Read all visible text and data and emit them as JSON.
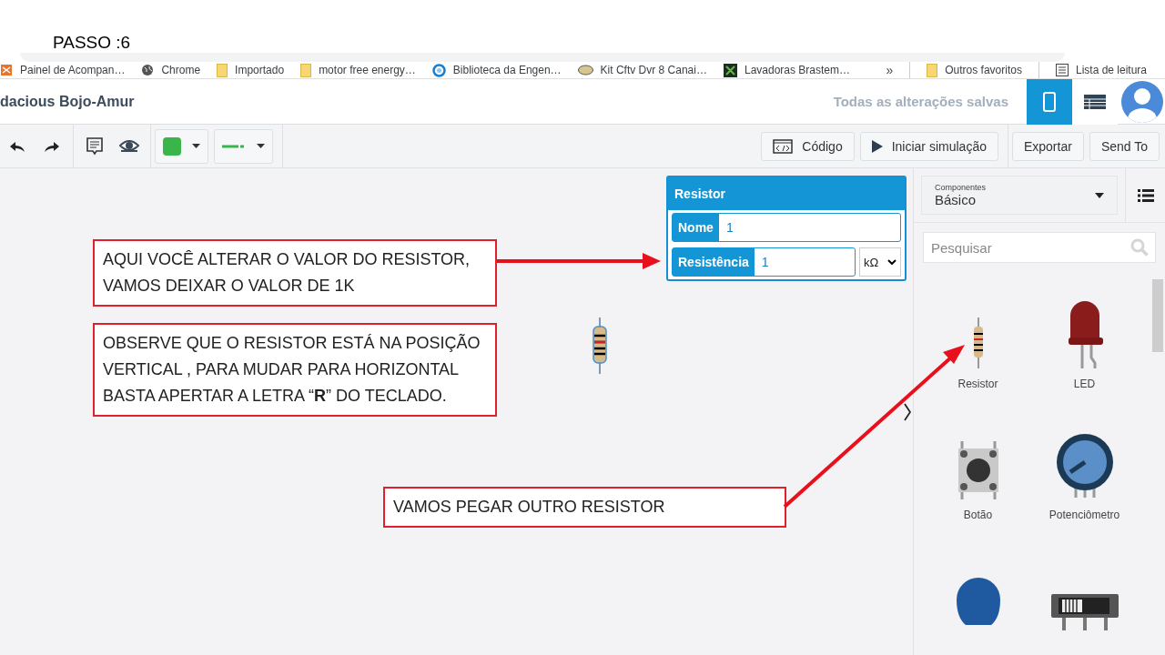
{
  "slide_title": "PASSO :6",
  "bookmarks": [
    {
      "label": "Painel de Acompan…",
      "kind": "app"
    },
    {
      "label": "Chrome",
      "kind": "globe"
    },
    {
      "label": "Importado",
      "kind": "folder"
    },
    {
      "label": "motor free energy…",
      "kind": "folder"
    },
    {
      "label": "Biblioteca da Engen…",
      "kind": "ring"
    },
    {
      "label": "Kit Cftv Dvr 8 Canai…",
      "kind": "bowl"
    },
    {
      "label": "Lavadoras Brastem…",
      "kind": "tile"
    }
  ],
  "bookmarks_more": "»",
  "bookmarks_right": [
    {
      "label": "Outros favoritos",
      "kind": "folder"
    },
    {
      "label": "Lista de leitura",
      "kind": "list"
    }
  ],
  "header": {
    "project_title": "dacious Bojo-Amur",
    "save_status": "Todas as alterações salvas",
    "views": [
      {
        "kind": "circuit",
        "selected": true
      },
      {
        "kind": "table",
        "selected": false
      }
    ]
  },
  "toolbar": {
    "buttons": [
      {
        "label": "Código",
        "kind": "code"
      },
      {
        "label": "Iniciar simulação",
        "kind": "play"
      },
      {
        "label": "Exportar",
        "kind": "plain"
      },
      {
        "label": "Send To",
        "kind": "plain"
      }
    ]
  },
  "properties": {
    "title": "Resistor",
    "fields": [
      {
        "label": "Nome",
        "value": "1"
      },
      {
        "label": "Resistência",
        "value": "1",
        "unit": "kΩ"
      }
    ]
  },
  "sidebar": {
    "category_label": "Componentes",
    "category": "Básico",
    "search_placeholder": "Pesquisar",
    "components": [
      {
        "label": "Resistor",
        "kind": "resistor"
      },
      {
        "label": "LED",
        "kind": "led"
      },
      {
        "label": "Botão",
        "kind": "button"
      },
      {
        "label": "Potenciômetro",
        "kind": "pot"
      },
      {
        "kind": "capacitor"
      },
      {
        "kind": "switch"
      }
    ]
  },
  "annotations": [
    {
      "text": "AQUI VOCÊ ALTERAR O VALOR DO RESISTOR, VAMOS DEIXAR O VALOR DE 1K"
    },
    {
      "text": "OBSERVE QUE O RESISTOR ESTÁ NA POSIÇÃO VERTICAL , PARA MUDAR PARA HORIZONTAL BASTA APERTAR A LETRA “**R**” DO TECLADO."
    },
    {
      "text": "VAMOS PEGAR OUTRO RESISTOR"
    }
  ]
}
